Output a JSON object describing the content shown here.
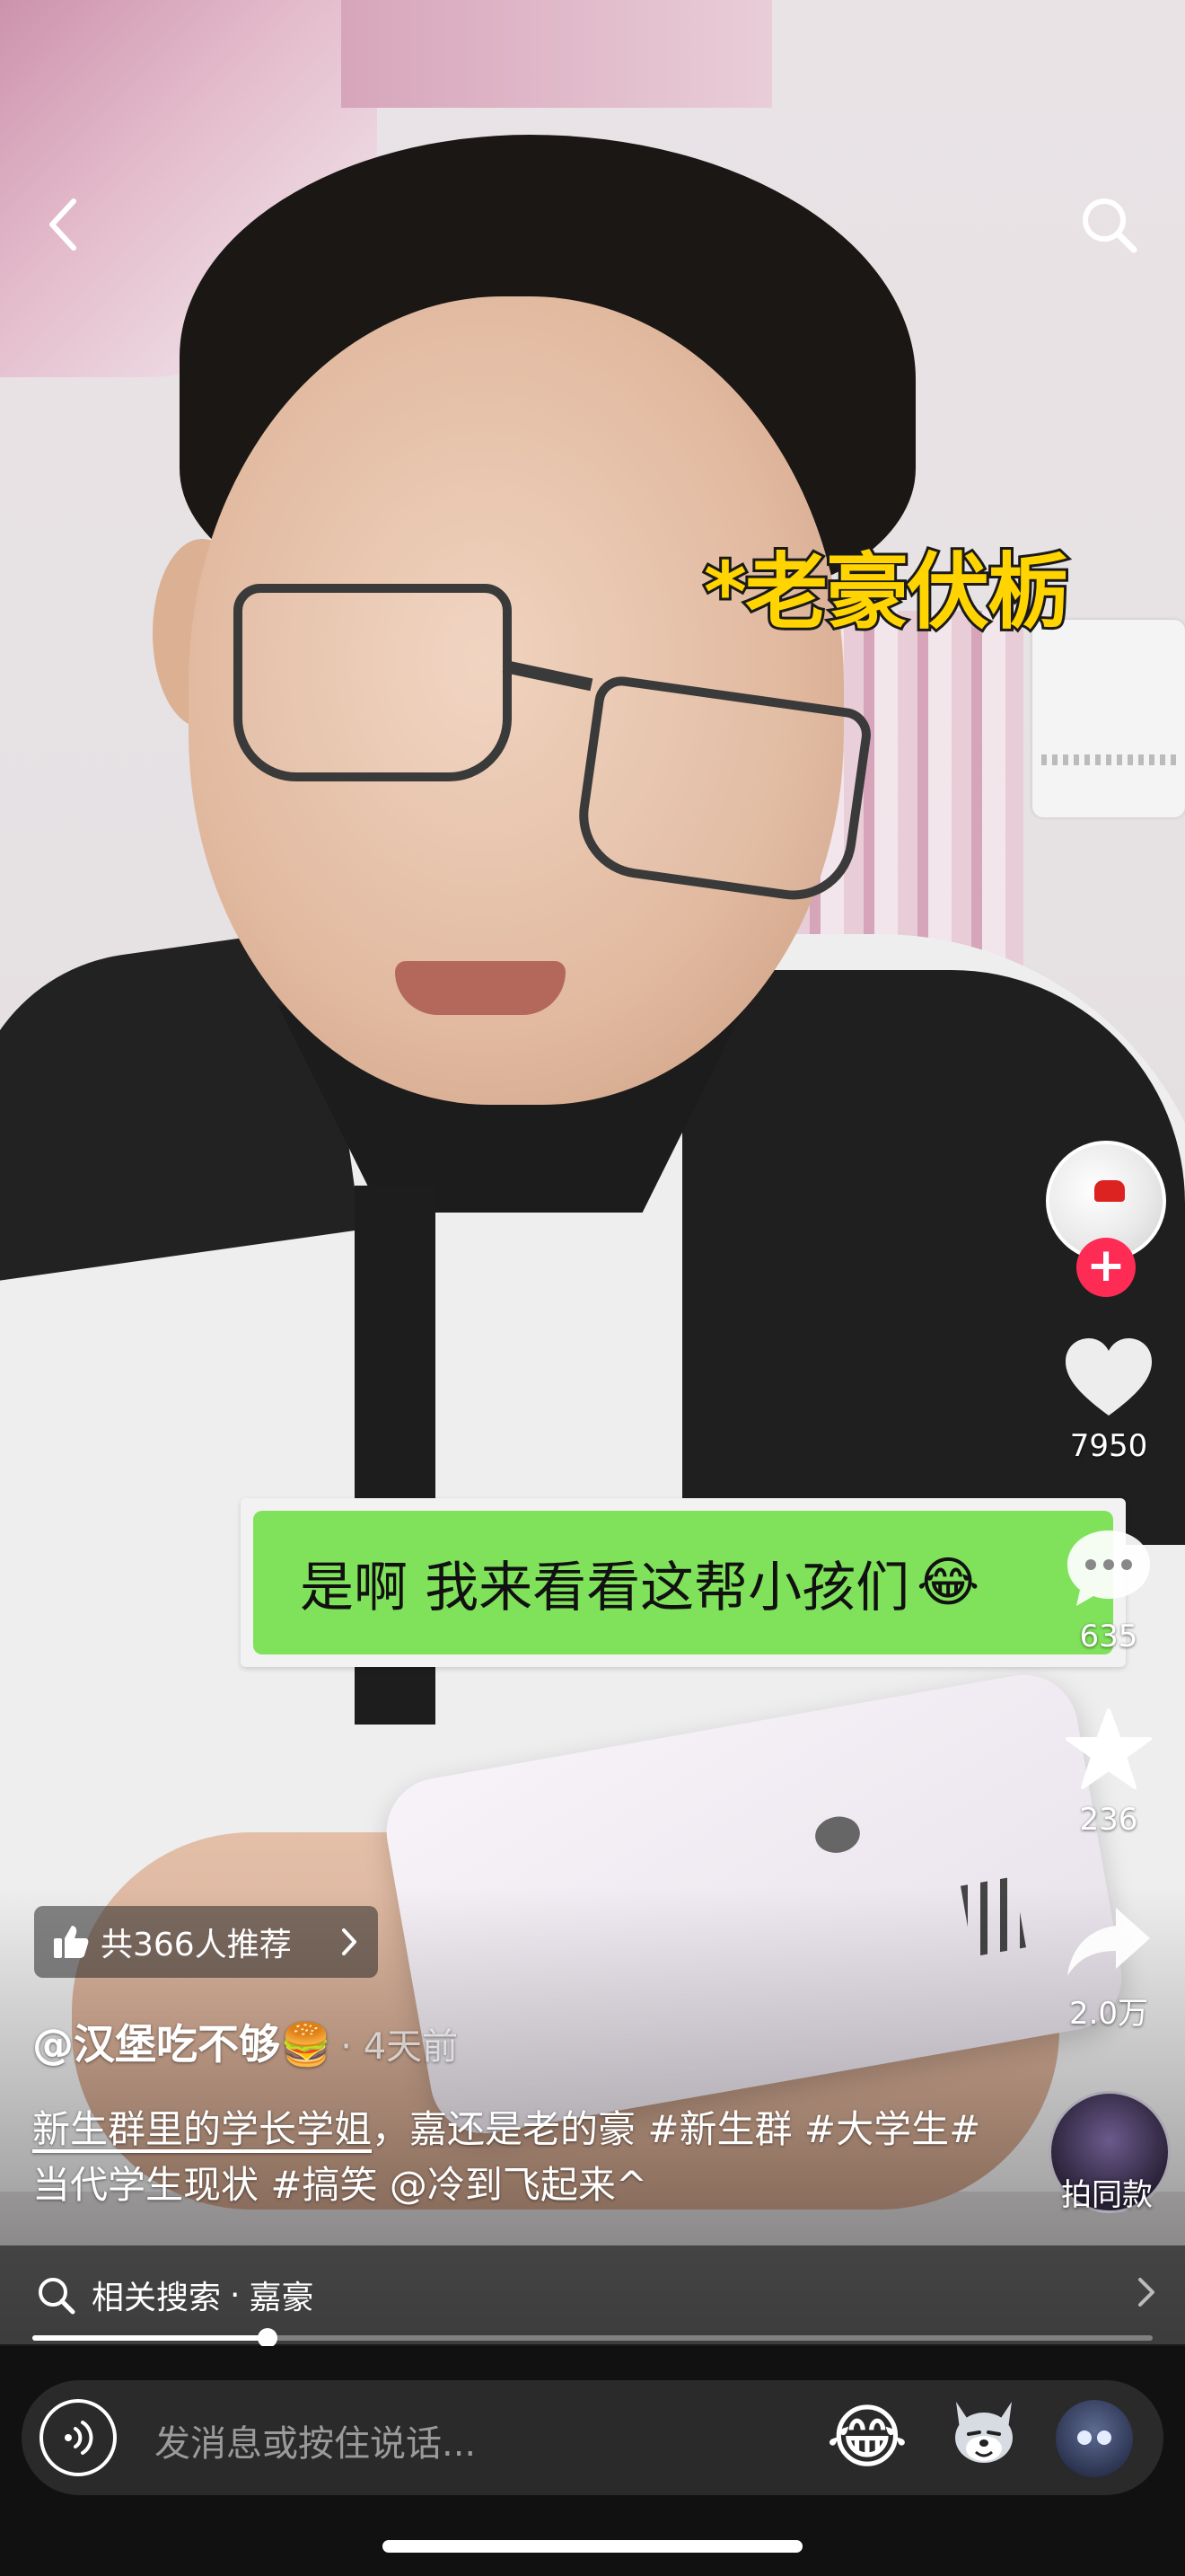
{
  "video": {
    "overlay_caption": "*老豪伏栃",
    "chat_message": "是啊 我来看看这帮小孩们",
    "chat_emoji": "😂"
  },
  "actions": {
    "likes": "7950",
    "comments": "635",
    "favorites": "236",
    "shares": "2.0万",
    "same_style": "拍同款"
  },
  "recommend": {
    "label": "共366人推荐"
  },
  "post": {
    "author": "@汉堡吃不够🍔",
    "time": "· 4天前",
    "desc_underlined": "新生群里的学长学姐",
    "desc_rest": "，嘉还是老的豪 #新生群 #大学生#当代学生现状 #搞笑 @冷到飞起来^"
  },
  "related_search": {
    "prefix": "相关搜索",
    "separator": "·",
    "term": "嘉豪"
  },
  "playback": {
    "progress_fraction": 0.21
  },
  "composer": {
    "placeholder": "发消息或按住说话...",
    "emoji_1": "😂",
    "emoji_2": "wolf-meme-emoji",
    "emoji_3": "blue-face-emoji"
  },
  "icons": {
    "back": "chevron-left-icon",
    "search": "search-icon",
    "like": "heart-icon",
    "comment": "comment-icon",
    "favorite": "star-icon",
    "share": "share-arrow-icon",
    "voice": "voice-wave-icon"
  },
  "colors": {
    "follow_plus": "#fe2c55",
    "caption_yellow": "#ffd400",
    "chat_green": "#7fe25a"
  }
}
